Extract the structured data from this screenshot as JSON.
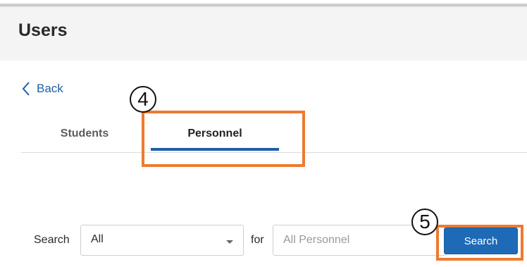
{
  "header": {
    "title": "Users"
  },
  "nav": {
    "back_label": "Back",
    "back_icon": "chevron-left-icon"
  },
  "tabs": [
    {
      "label": "Students",
      "active": false
    },
    {
      "label": "Personnel",
      "active": true
    }
  ],
  "annotations": {
    "step_tabs": "4",
    "step_search": "5"
  },
  "search_bar": {
    "search_label": "Search",
    "filter_selected": "All",
    "for_label": "for",
    "query_value": "",
    "query_placeholder": "All Personnel",
    "button_label": "Search"
  },
  "colors": {
    "accent": "#1f5fa6",
    "button": "#1f6ab7",
    "callout": "#ee7a31",
    "header_bg": "#f4f4f4"
  }
}
